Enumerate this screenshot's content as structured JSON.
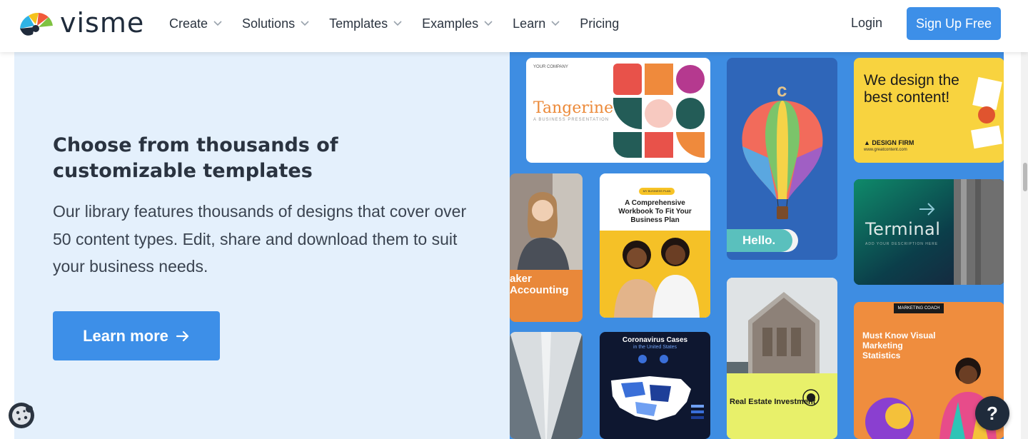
{
  "header": {
    "logo_text": "visme",
    "nav": [
      {
        "label": "Create",
        "dropdown": true
      },
      {
        "label": "Solutions",
        "dropdown": true
      },
      {
        "label": "Templates",
        "dropdown": true
      },
      {
        "label": "Examples",
        "dropdown": true
      },
      {
        "label": "Learn",
        "dropdown": true
      },
      {
        "label": "Pricing",
        "dropdown": false
      }
    ],
    "login_label": "Login",
    "signup_label": "Sign Up Free"
  },
  "hero": {
    "headline": "Choose from thousands of customizable templates",
    "body": "Our library features thousands of designs that cover over 50 content types. Edit, share and download them to suit your business needs.",
    "cta_label": "Learn more"
  },
  "collage": {
    "tangerine": {
      "title": "Tangerine",
      "subtitle": "A BUSINESS PRESENTATION",
      "tiny": "YOUR COMPANY"
    },
    "balloon": {
      "hello": "Hello.",
      "mark": "c"
    },
    "design_firm": {
      "title": "We design the best content!",
      "firm": "▲ DESIGN FIRM",
      "url": "www.greatcontent.com"
    },
    "accounting": {
      "text": "aker Accounting"
    },
    "plan": {
      "pill": "MY BUSINESS PLAN",
      "title": "A Comprehensive Workbook To Fit Your Business Plan"
    },
    "terminal": {
      "title": "Terminal",
      "subtitle": "ADD YOUR DESCRIPTION HERE"
    },
    "corona": {
      "title": "Coronavirus Cases",
      "subtitle": "in the United States"
    },
    "real_estate": {
      "title": "Real Estate Investment"
    },
    "marketing": {
      "tag": "MARKETING COACH",
      "title": "Must Know Visual Marketing Statistics"
    }
  },
  "widgets": {
    "help_label": "?"
  },
  "colors": {
    "accent": "#3d8fe8",
    "panel_bg": "#e4f0fc",
    "collage_bg": "#3e8de2",
    "text_dark": "#2a3340"
  }
}
